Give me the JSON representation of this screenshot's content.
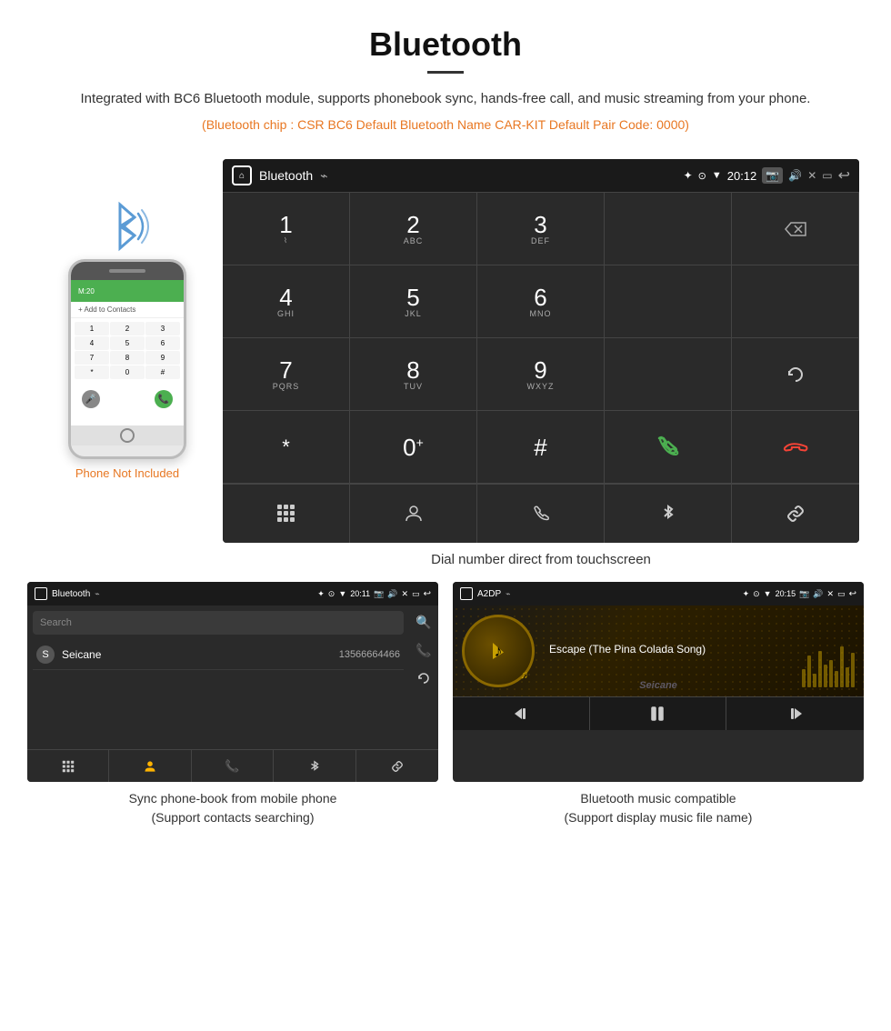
{
  "header": {
    "title": "Bluetooth",
    "description": "Integrated with BC6 Bluetooth module, supports phonebook sync, hands-free call, and music streaming from your phone.",
    "specs": "(Bluetooth chip : CSR BC6    Default Bluetooth Name CAR-KIT    Default Pair Code: 0000)"
  },
  "mainScreen": {
    "statusBar": {
      "screenName": "Bluetooth",
      "time": "20:12"
    },
    "dialpad": [
      {
        "num": "1",
        "sub": ""
      },
      {
        "num": "2",
        "sub": "ABC"
      },
      {
        "num": "3",
        "sub": "DEF"
      },
      {
        "num": "",
        "sub": ""
      },
      {
        "num": "⌫",
        "sub": ""
      },
      {
        "num": "4",
        "sub": "GHI"
      },
      {
        "num": "5",
        "sub": "JKL"
      },
      {
        "num": "6",
        "sub": "MNO"
      },
      {
        "num": "",
        "sub": ""
      },
      {
        "num": "",
        "sub": ""
      },
      {
        "num": "7",
        "sub": "PQRS"
      },
      {
        "num": "8",
        "sub": "TUV"
      },
      {
        "num": "9",
        "sub": "WXYZ"
      },
      {
        "num": "",
        "sub": ""
      },
      {
        "num": "↻",
        "sub": ""
      },
      {
        "num": "*",
        "sub": ""
      },
      {
        "num": "0+",
        "sub": ""
      },
      {
        "num": "#",
        "sub": ""
      },
      {
        "num": "📞",
        "sub": ""
      },
      {
        "num": "",
        "sub": ""
      },
      {
        "num": "⊞",
        "sub": ""
      },
      {
        "num": "👤",
        "sub": ""
      },
      {
        "num": "📱",
        "sub": ""
      },
      {
        "num": "✱",
        "sub": ""
      },
      {
        "num": "🔗",
        "sub": ""
      }
    ],
    "caption": "Dial number direct from touchscreen"
  },
  "phonebookScreen": {
    "statusBar": {
      "screenName": "Bluetooth",
      "time": "20:11"
    },
    "searchPlaceholder": "Search",
    "contacts": [
      {
        "letter": "S",
        "name": "Seicane",
        "number": "13566664466"
      }
    ],
    "caption1": "Sync phone-book from mobile phone",
    "caption2": "(Support contacts searching)"
  },
  "musicScreen": {
    "statusBar": {
      "screenName": "A2DP",
      "time": "20:15"
    },
    "songTitle": "Escape (The Pina Colada Song)",
    "caption1": "Bluetooth music compatible",
    "caption2": "(Support display music file name)"
  },
  "phone": {
    "notIncluded": "Phone Not Included"
  }
}
